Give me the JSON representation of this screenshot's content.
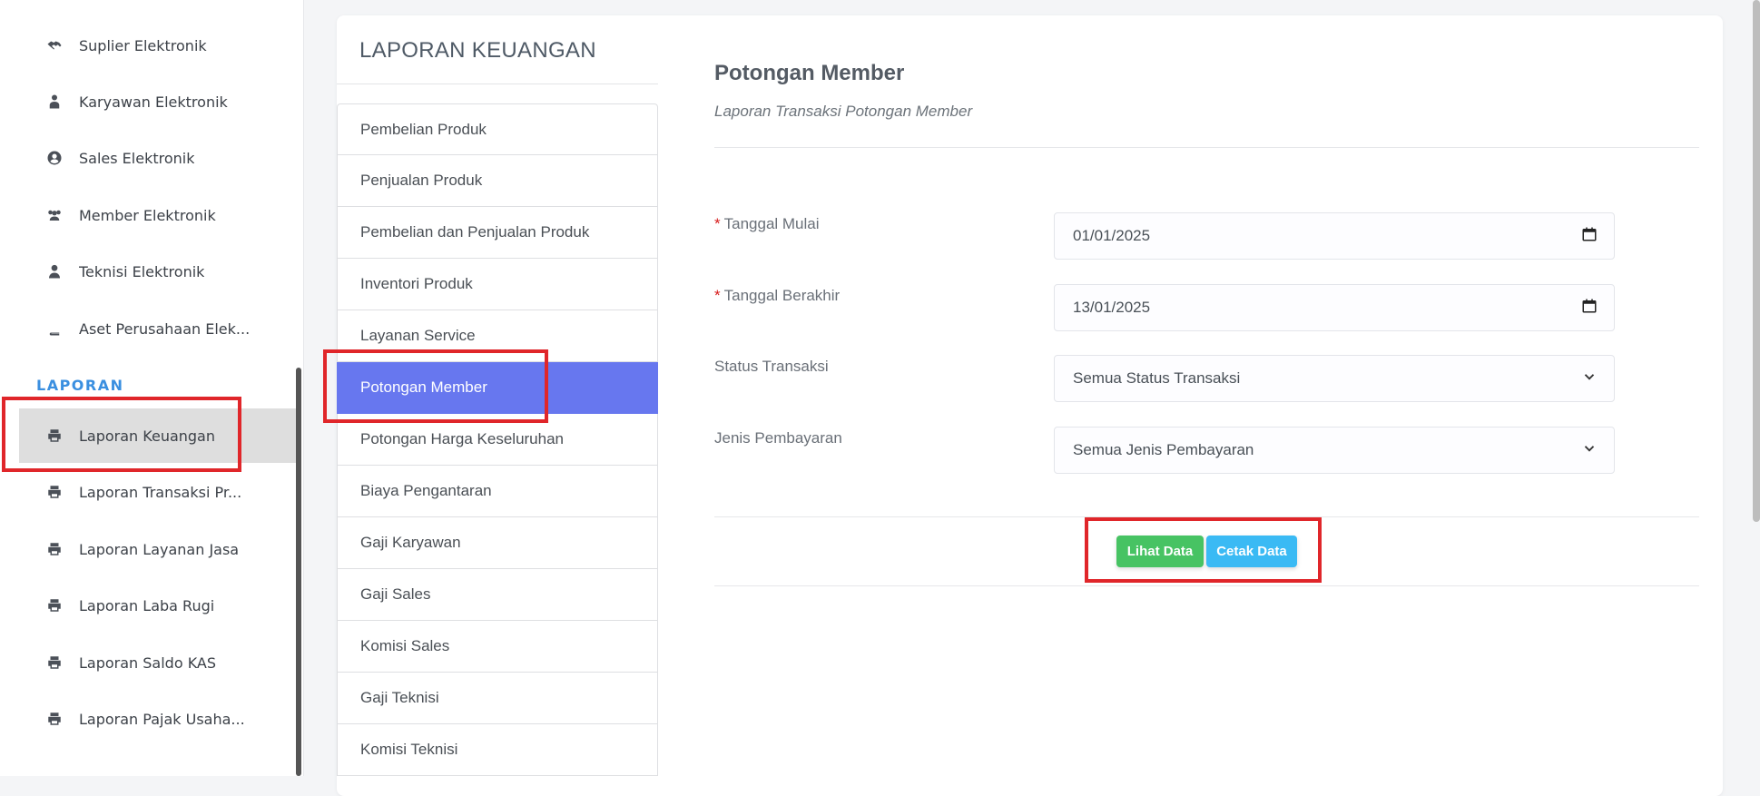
{
  "sidebar": {
    "items_top": [
      {
        "label": "Suplier Elektronik",
        "icon": "handshake-icon"
      },
      {
        "label": "Karyawan Elektronik",
        "icon": "user-tie-icon"
      },
      {
        "label": "Sales Elektronik",
        "icon": "user-circle-icon"
      },
      {
        "label": "Member Elektronik",
        "icon": "users-icon"
      },
      {
        "label": "Teknisi Elektronik",
        "icon": "user-icon"
      },
      {
        "label": "Aset Perusahaan Elek...",
        "icon": "book-icon"
      }
    ],
    "section_title": "LAPORAN",
    "items_laporan": [
      {
        "label": "Laporan Keuangan",
        "icon": "print-icon"
      },
      {
        "label": "Laporan Transaksi Pr...",
        "icon": "print-icon"
      },
      {
        "label": "Laporan Layanan Jasa",
        "icon": "print-icon"
      },
      {
        "label": "Laporan Laba Rugi",
        "icon": "print-icon"
      },
      {
        "label": "Laporan Saldo KAS",
        "icon": "print-icon"
      },
      {
        "label": "Laporan Pajak Usaha...",
        "icon": "print-icon"
      }
    ]
  },
  "report": {
    "title": "LAPORAN KEUANGAN",
    "menu": [
      "Pembelian Produk",
      "Penjualan Produk",
      "Pembelian dan Penjualan Produk",
      "Inventori Produk",
      "Layanan Service",
      "Potongan Member",
      "Potongan Harga Keseluruhan",
      "Biaya Pengantaran",
      "Gaji Karyawan",
      "Gaji Sales",
      "Komisi Sales",
      "Gaji Teknisi",
      "Komisi Teknisi"
    ]
  },
  "form": {
    "title": "Potongan Member",
    "subtitle": "Laporan Transaksi Potongan Member",
    "required_mark": "*",
    "start_date_label": "Tanggal Mulai",
    "start_date_value": "01/01/2025",
    "end_date_label": "Tanggal Berakhir",
    "end_date_value": "13/01/2025",
    "status_label": "Status Transaksi",
    "status_value": "Semua Status Transaksi",
    "payment_label": "Jenis Pembayaran",
    "payment_value": "Semua Jenis Pembayaran",
    "view_button": "Lihat Data",
    "print_button": "Cetak Data"
  },
  "colors": {
    "accent": "#6777ef",
    "section_title": "#3a8fe0",
    "view_button": "#47c363",
    "print_button": "#3abaf4",
    "highlight": "#e0262a"
  }
}
